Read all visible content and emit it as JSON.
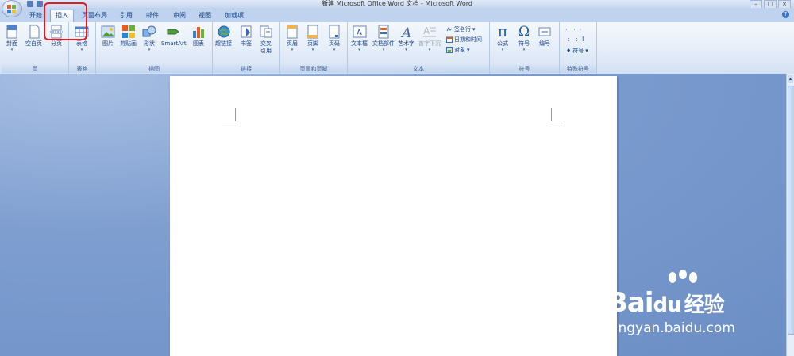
{
  "window": {
    "title": "新建 Microsoft Office Word 文档 - Microsoft Word"
  },
  "tabs": [
    {
      "label": "开始",
      "active": false
    },
    {
      "label": "插入",
      "active": true
    },
    {
      "label": "页面布局",
      "active": false
    },
    {
      "label": "引用",
      "active": false
    },
    {
      "label": "邮件",
      "active": false
    },
    {
      "label": "审阅",
      "active": false
    },
    {
      "label": "视图",
      "active": false
    },
    {
      "label": "加载项",
      "active": false
    }
  ],
  "groups": {
    "page": {
      "label": "页",
      "buttons": [
        "封面",
        "空白页",
        "分页"
      ]
    },
    "table": {
      "label": "表格",
      "buttons": [
        "表格"
      ]
    },
    "illustrations": {
      "label": "插图",
      "buttons": [
        "图片",
        "剪贴画",
        "形状",
        "SmartArt",
        "图表"
      ]
    },
    "links": {
      "label": "链接",
      "buttons": [
        "超链接",
        "书签",
        "交叉",
        "引用"
      ]
    },
    "header_footer": {
      "label": "页眉和页脚",
      "buttons": [
        "页眉",
        "页脚",
        "页码"
      ]
    },
    "text": {
      "label": "文本",
      "buttons": [
        "文本框",
        "文档部件",
        "艺术字",
        "首字下沉"
      ],
      "small": [
        "签名行",
        "日期和时间",
        "对象"
      ]
    },
    "symbols": {
      "label": "符号",
      "buttons": [
        "公式",
        "符号",
        "编号"
      ]
    },
    "special": {
      "label": "特殊符号",
      "button": "符号"
    }
  },
  "watermark": {
    "brand": "Bai",
    "brand_cn": "经验",
    "url": "jingyan.baidu.com"
  },
  "colors": {
    "accent": "#15428b",
    "highlight": "#e01b23",
    "workspace": "#6b8ec5"
  }
}
